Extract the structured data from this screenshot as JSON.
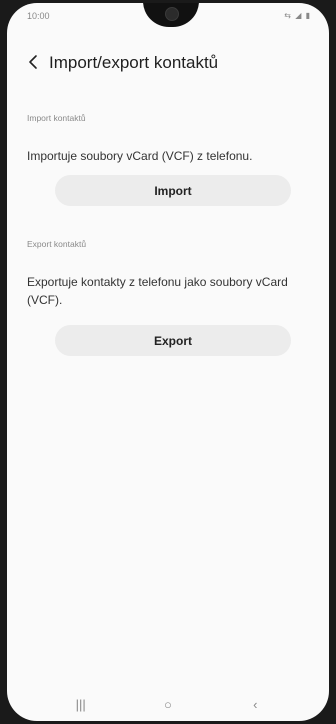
{
  "status_bar": {
    "time": "10:00",
    "icons": "⇆ ◢ ▮"
  },
  "header": {
    "title": "Import/export kontaktů",
    "back_icon": "chevron-left-icon"
  },
  "import_section": {
    "label": "Import kontaktů",
    "description": "Importuje soubory vCard (VCF) z telefonu.",
    "button_label": "Import"
  },
  "export_section": {
    "label": "Export kontaktů",
    "description": "Exportuje kontakty z telefonu jako soubory vCard (VCF).",
    "button_label": "Export"
  },
  "navigation_bar": {
    "recents": "|||",
    "home": "○",
    "back": "‹"
  },
  "colors": {
    "background": "#fafafa",
    "button": "#ececec",
    "text": "#333333",
    "label": "#8a8a8a"
  }
}
